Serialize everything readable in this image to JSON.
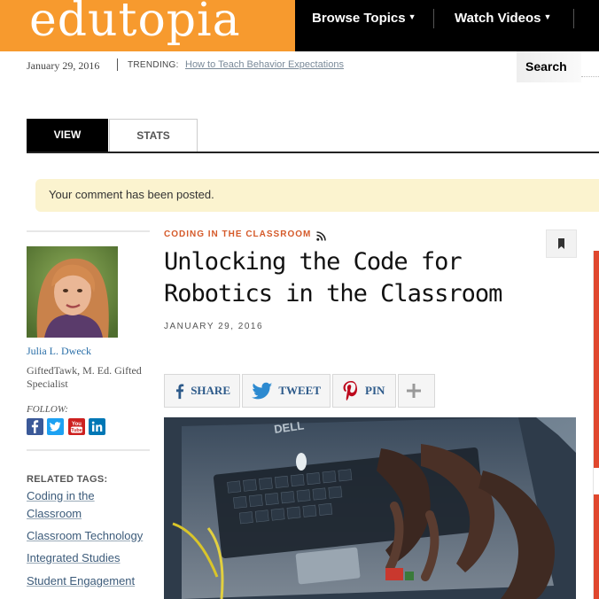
{
  "header": {
    "logo": "edutopia",
    "nav": [
      {
        "label": "Browse Topics"
      },
      {
        "label": "Watch Videos"
      }
    ]
  },
  "subheader": {
    "date": "January 29, 2016",
    "trending_label": "TRENDING:",
    "trending_link": "How to Teach Behavior Expectations",
    "search_label": "Search"
  },
  "tabs": [
    {
      "label": "VIEW",
      "active": true
    },
    {
      "label": "STATS",
      "active": false
    }
  ],
  "notice": "Your comment has been posted.",
  "author": {
    "name": "Julia L. Dweck",
    "title": "GiftedTawk, M. Ed. Gifted Specialist",
    "follow_label": "FOLLOW:",
    "social": [
      "facebook-icon",
      "twitter-icon",
      "youtube-icon",
      "linkedin-icon"
    ]
  },
  "related": {
    "label": "RELATED TAGS:",
    "tags": [
      "Coding in the Classroom",
      "Classroom Technology",
      "Integrated Studies",
      "Student Engagement"
    ]
  },
  "article": {
    "kicker": "CODING IN THE CLASSROOM",
    "title": "Unlocking the Code for Robotics in the Classroom",
    "date": "JANUARY 29, 2016",
    "share": [
      {
        "label": "SHARE",
        "icon": "facebook-icon"
      },
      {
        "label": "TWEET",
        "icon": "twitter-icon"
      },
      {
        "label": "PIN",
        "icon": "pinterest-icon"
      },
      {
        "label": "",
        "icon": "plus-icon"
      }
    ]
  },
  "colors": {
    "brand_orange": "#f79a2e",
    "nav_black": "#000000",
    "kicker_orange": "#d55a2a",
    "notice_yellow": "#fbf3cf",
    "link_blue": "#2a6fa8"
  }
}
